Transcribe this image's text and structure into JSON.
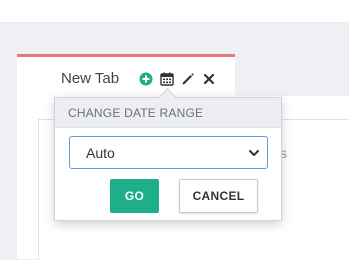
{
  "tab": {
    "label": "New Tab",
    "icons": [
      "plus-circle-icon",
      "calendar-icon",
      "pencil-icon",
      "close-icon"
    ]
  },
  "background": {
    "partial_text": "s"
  },
  "date_range_popover": {
    "title": "CHANGE DATE RANGE",
    "select": {
      "selected_value": "Auto"
    },
    "go_label": "GO",
    "cancel_label": "CANCEL"
  },
  "colors": {
    "tab_accent": "#e8797a",
    "go_button": "#1fae8a",
    "plus_icon": "#1fae8a",
    "select_focus_border": "#5fa0d8"
  }
}
